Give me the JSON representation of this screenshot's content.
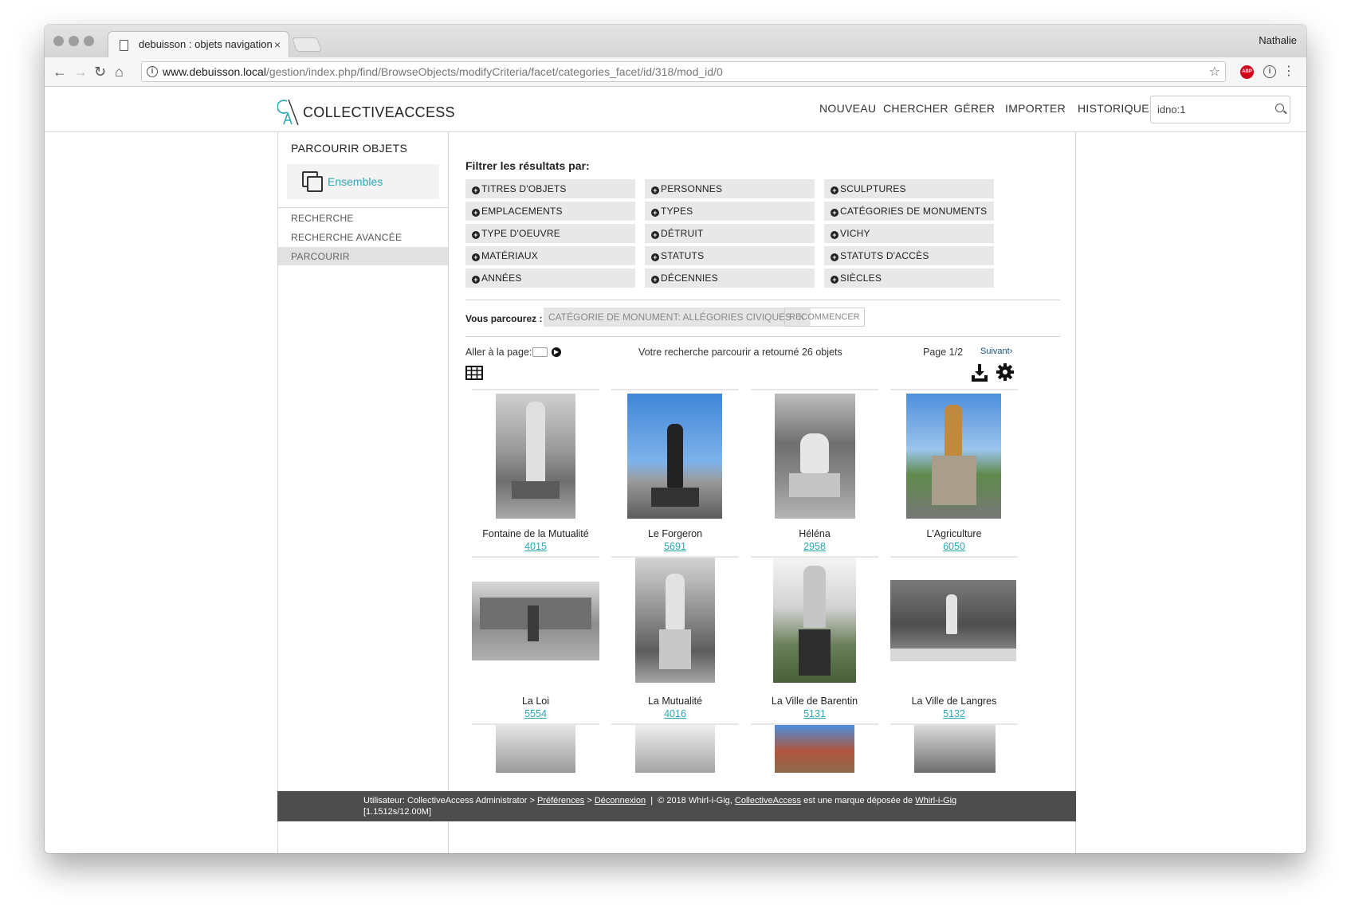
{
  "browser": {
    "tab_title": "debuisson : objets navigation",
    "profile_name": "Nathalie",
    "url_host": "www.debuisson.local",
    "url_path": "/gestion/index.php/find/BrowseObjects/modifyCriteria/facet/categories_facet/id/318/mod_id/0",
    "extension_abp": "ABP"
  },
  "header": {
    "logo_text": "COLLECTIVEACCESS",
    "nav": [
      "NOUVEAU",
      "CHERCHER",
      "GÉRER",
      "IMPORTER",
      "HISTORIQUE"
    ],
    "search_value": "idno:1"
  },
  "sidebar": {
    "title": "PARCOURIR OBJETS",
    "sets_label": "Ensembles",
    "links": [
      "RECHERCHE",
      "RECHERCHE AVANCÉE",
      "PARCOURIR"
    ],
    "active_link": "PARCOURIR"
  },
  "filters": {
    "title": "Filtrer les résultats par:",
    "facets": [
      [
        "TITRES D'OBJETS",
        "EMPLACEMENTS",
        "TYPE D'OEUVRE",
        "MATÉRIAUX",
        "ANNÉES"
      ],
      [
        "PERSONNES",
        "TYPES",
        "DÉTRUIT",
        "STATUTS",
        "DÉCENNIES"
      ],
      [
        "SCULPTURES",
        "CATÉGORIES DE MONUMENTS",
        "VICHY",
        "STATUTS D'ACCÈS",
        "SIÈCLES"
      ]
    ]
  },
  "browse": {
    "label": "Vous parcourez :",
    "criterion": "CATÉGORIE DE MONUMENT: ALLÉGORIES CIVIQUES",
    "criterion_remove": "X",
    "restart": "RECOMMENCER"
  },
  "pager": {
    "goto_label": "Aller à la page:",
    "result_text": "Votre recherche parcourir a retourné 26 objets",
    "page_text": "Page 1/2",
    "next_label": "Suivant",
    "next_arrow": "›"
  },
  "results": [
    {
      "title": "Fontaine de la Mutualité",
      "idno": "4015"
    },
    {
      "title": "Le Forgeron",
      "idno": "5691"
    },
    {
      "title": "Héléna",
      "idno": "2958"
    },
    {
      "title": "L'Agriculture",
      "idno": "6050"
    },
    {
      "title": "La Loi",
      "idno": "5554"
    },
    {
      "title": "La Mutualité",
      "idno": "4016"
    },
    {
      "title": "La Ville de Barentin",
      "idno": "5131"
    },
    {
      "title": "La Ville de Langres",
      "idno": "5132"
    }
  ],
  "footer": {
    "user": "Utilisateur: CollectiveAccess Administrator",
    "sep1": ">",
    "preferences": "Préférences",
    "sep2": ">",
    "logout": "Déconnexion",
    "divider": "|",
    "copyright": "© 2018 Whirl-i-Gig,",
    "ca_link": "CollectiveAccess",
    "trademark": "est une marque déposée de",
    "wig_link": "Whirl-i-Gig",
    "timing": "[1.1512s/12.00M]"
  },
  "colors": {
    "accent": "#2aa7b5",
    "footer_bg": "#4d4d4d",
    "facet_bg": "#e8e8e8",
    "active_side": "#e1e1e1"
  }
}
